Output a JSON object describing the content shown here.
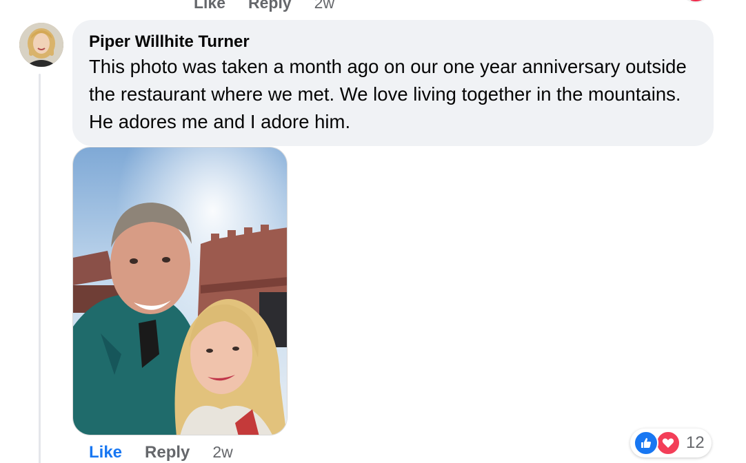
{
  "previous_comment": {
    "like_label": "Like",
    "reply_label": "Reply",
    "time": "2w"
  },
  "comment": {
    "author": "Piper Willhite Turner",
    "text": "This photo was taken a month ago on our one year anniversary outside the restaurant where we met. We love living together in the mountains. He adores me and I adore him.",
    "like_label": "Like",
    "reply_label": "Reply",
    "time": "2w",
    "reactions": {
      "icons": [
        "like-icon",
        "love-icon"
      ],
      "count": "12"
    }
  },
  "colors": {
    "bubble_bg": "#f0f2f5",
    "like_blue": "#1877f2",
    "love_red": "#f33e58",
    "meta_gray": "#65676b",
    "text": "#050505"
  }
}
